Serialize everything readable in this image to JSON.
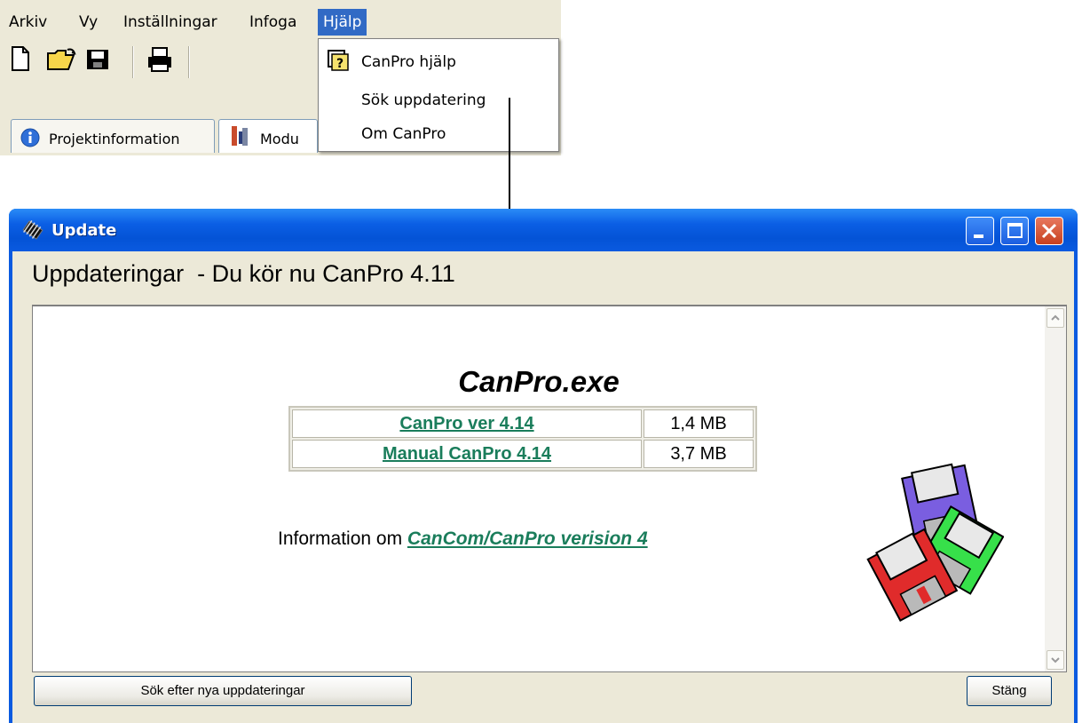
{
  "menu": {
    "items": [
      "Arkiv",
      "Vy",
      "Inställningar",
      "Infoga",
      "Hjälp"
    ],
    "active": "Hjälp"
  },
  "tabs": {
    "project_info": "Projektinformation",
    "modules_partial": "Modu"
  },
  "help_menu": {
    "items": [
      "CanPro hjälp",
      "Sök uppdatering",
      "Om CanPro"
    ]
  },
  "window": {
    "title": "Update",
    "heading": "Uppdateringar  - Du kör nu CanPro 4.11"
  },
  "content": {
    "exe_title": "CanPro.exe",
    "files": [
      {
        "name": "CanPro ver 4.14",
        "size": "1,4 MB"
      },
      {
        "name": "Manual CanPro 4.14",
        "size": "3,7 MB"
      }
    ],
    "info_prefix": "Information om ",
    "info_link": "CanCom/CanPro verision 4"
  },
  "buttons": {
    "search_updates": "Sök efter nya uppdateringar",
    "close": "Stäng"
  },
  "colors": {
    "link": "#1a7d5b",
    "titlebar": "#0a5ae0",
    "menu_highlight": "#316ac5"
  }
}
